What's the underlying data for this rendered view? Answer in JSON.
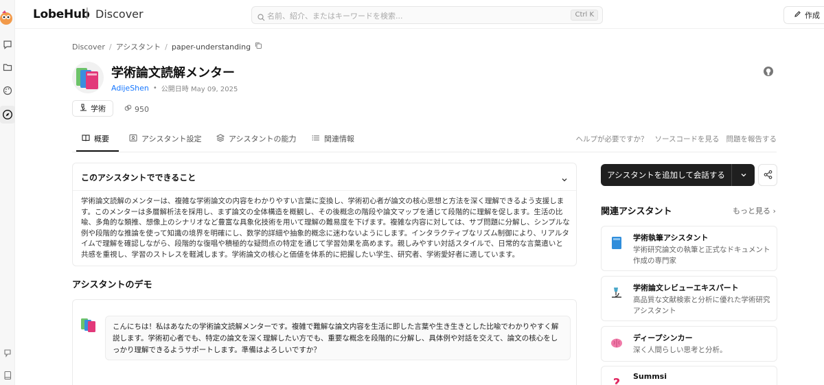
{
  "topbar": {
    "brand": "LobeHub",
    "separator": "|",
    "section": "Discover",
    "search_placeholder": "名前、紹介、またはキーワードを検索...",
    "search_shortcut": "Ctrl K",
    "create_label": "作成"
  },
  "breadcrumb": {
    "items": [
      "Discover",
      "アシスタント",
      "paper-understanding"
    ],
    "sep": "/"
  },
  "agent": {
    "title": "学術論文読解メンター",
    "author": "AdijeShen",
    "dot": "•",
    "published": "公開日時 May 09, 2025",
    "tag": "学術",
    "tokens": "950"
  },
  "tabs": {
    "items": [
      "概要",
      "アシスタント設定",
      "アシスタントの能力",
      "関連情報"
    ],
    "links": [
      "ヘルプが必要ですか？",
      "ソースコードを見る",
      "問題を報告する"
    ]
  },
  "overview": {
    "heading": "このアシスタントでできること",
    "body": "学術論文読解のメンターは、複雑な学術論文の内容をわかりやすい言葉に変換し、学術初心者が論文の核心思想と方法を深く理解できるよう支援します。このメンターは多層解析法を採用し、まず論文の全体構造を概観し、その後概念の階段や論文マップを通じて段階的に理解を促します。生活の比喩、多角的な類推、想像上のシナリオなど豊富な具象化技術を用いて理解の難易度を下げます。複雑な内容に対しては、サブ問題に分解し、シンプルな例や段階的な推論を使って知識の境界を明確にし、数学的詳細や抽象的概念に迷わないようにします。インタラクティブなリズム制御により、リアルタイムで理解を確認しながら、段階的な復唱や積極的な疑問点の特定を通じて学習効果を高めます。親しみやすい対話スタイルで、日常的な言葉遣いと共感を重視し、学習のストレスを軽減します。学術論文の核心と価値を体系的に把握したい学生、研究者、学術愛好者に適しています。"
  },
  "demo": {
    "heading": "アシスタントのデモ",
    "message": "こんにちは！私はあなたの学術論文読解メンターです。複雑で難解な論文内容を生活に即した言葉や生き生きとした比喩でわかりやすく解説します。学術初心者でも、特定の論文を深く理解したい方でも、重要な概念を段階的に分解し、具体例や対話を交えて、論文の核心をしっかり理解できるようサポートします。準備はよろしいですか？"
  },
  "sidebar_right": {
    "add_button": "アシスタントを追加して会話する",
    "related_title": "関連アシスタント",
    "more": "もっと見る",
    "related": [
      {
        "name": "学術執筆アシスタント",
        "desc": "学術研究論文の執筆と正式なドキュメント作成の専門家",
        "icon": "book-icon"
      },
      {
        "name": "学術論文レビューエキスパート",
        "desc": "高品質な文献検索と分析に優れた学術研究アシスタント",
        "icon": "microscope-icon"
      },
      {
        "name": "ディープシンカー",
        "desc": "深く人間らしい思考と分析。",
        "icon": "brain-icon"
      },
      {
        "name": "Summsi",
        "desc": "",
        "icon": "question-icon"
      }
    ]
  },
  "colors": {
    "accent": "#1677ff",
    "primary_button": "#1f1f1f"
  }
}
